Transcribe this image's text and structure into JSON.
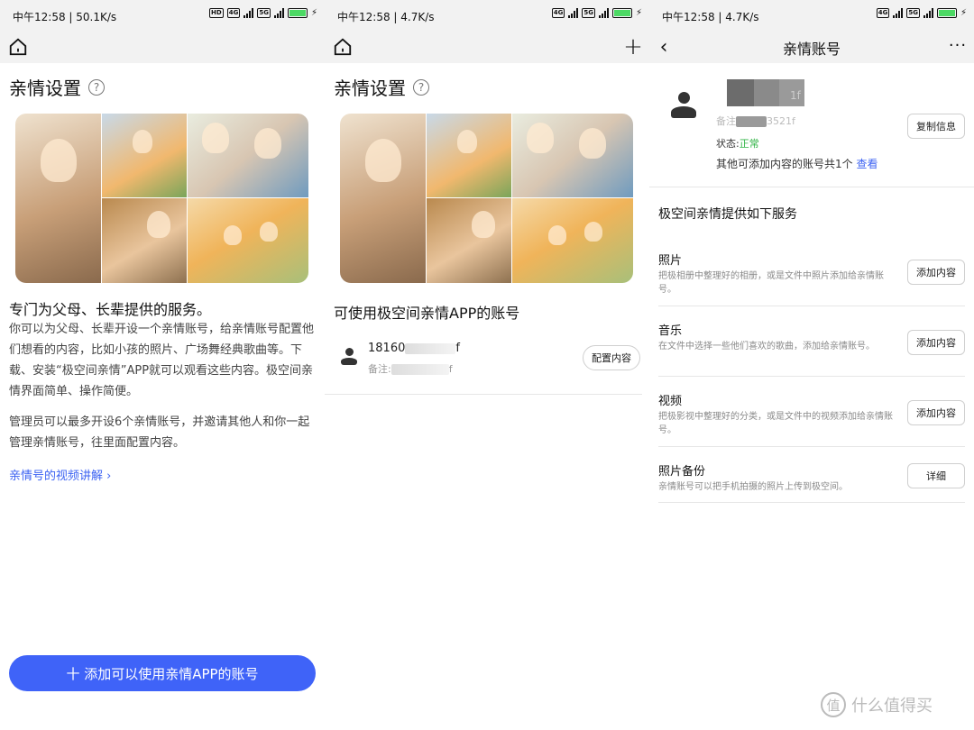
{
  "status_bars": [
    {
      "time": "中午12:58 | 50.1K/s",
      "battery": "100"
    },
    {
      "time": "中午12:58 | 4.7K/s",
      "battery": "100"
    },
    {
      "time": "中午12:58 | 4.7K/s",
      "battery": "100"
    }
  ],
  "status_icons": {
    "hd": "HD",
    "net4g": "4G",
    "net5g": "5G",
    "charging": "⚡"
  },
  "panel1": {
    "title": "亲情设置",
    "help_icon": "?",
    "headline": "专门为父母、长辈提供的服务。",
    "para1": "你可以为父母、长辈开设一个亲情账号，给亲情账号配置他们想看的内容，比如小孩的照片、广场舞经典歌曲等。下载、安装“极空间亲情”APP就可以观看这些内容。极空间亲情界面简单、操作简便。",
    "para2": "管理员可以最多开设6个亲情账号，并邀请其他人和你一起管理亲情账号，往里面配置内容。",
    "video_link": "亲情号的视频讲解",
    "video_link_arrow": "›",
    "add_button": "十 添加可以使用亲情APP的账号"
  },
  "panel2": {
    "title": "亲情设置",
    "help_icon": "?",
    "plus_icon": "+",
    "section_title": "可使用极空间亲情APP的账号",
    "account_name_prefix": "18160",
    "account_name_suffix": "f",
    "account_note_prefix": "备注:",
    "account_note_suffix": "f",
    "config_button": "配置内容"
  },
  "panel3": {
    "title": "亲情账号",
    "back_icon": "‹",
    "more_icon": "···",
    "profile_name_suffix": "1f",
    "profile_note_prefix": "备注",
    "profile_note_suffix": "3521f",
    "status_label": "状态:",
    "status_value": "正常",
    "other_accounts": "其他可添加内容的账号共1个",
    "view_link": "查看",
    "copy_button": "复制信息",
    "services_title": "极空间亲情提供如下服务",
    "services": [
      {
        "title": "照片",
        "desc": "把极相册中整理好的相册，或是文件中照片添加给亲情账号。",
        "button": "添加内容"
      },
      {
        "title": "音乐",
        "desc": "在文件中选择一些他们喜欢的歌曲，添加给亲情账号。",
        "button": "添加内容"
      },
      {
        "title": "视频",
        "desc": "把极影视中整理好的分类，或是文件中的视频添加给亲情账号。",
        "button": "添加内容"
      },
      {
        "title": "照片备份",
        "desc": "亲情账号可以把手机拍摄的照片上传到极空间。",
        "button": "详细"
      }
    ]
  },
  "watermark": {
    "logo": "值",
    "text": "什么值得买"
  },
  "colors": {
    "accent": "#3f63f8",
    "link": "#3d63f2",
    "ok": "#2fb344",
    "navbar": "#f2f2f2"
  }
}
